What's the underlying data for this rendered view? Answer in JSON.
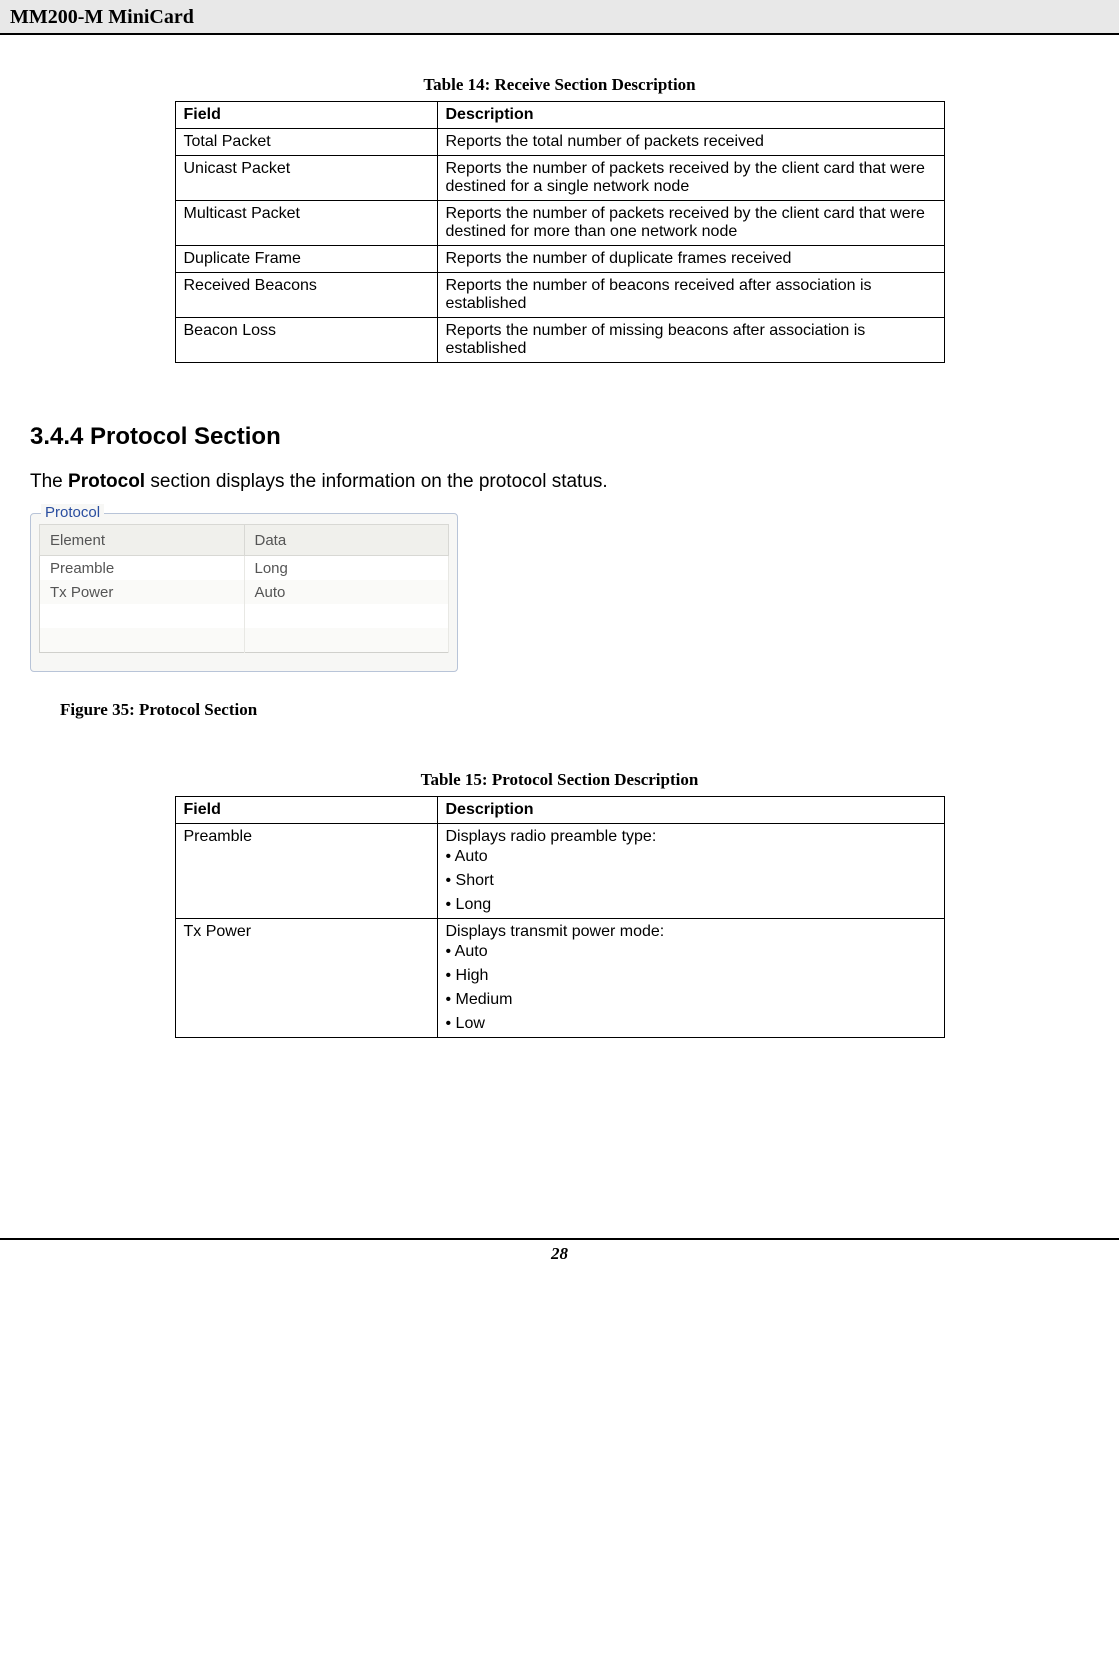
{
  "header": {
    "title": "MM200-M MiniCard"
  },
  "table14": {
    "caption": "Table 14: Receive Section Description",
    "head_field": "Field",
    "head_desc": "Description",
    "rows": [
      {
        "field": "Total Packet",
        "desc": "Reports the total number of packets received"
      },
      {
        "field": "Unicast Packet",
        "desc": "Reports the number of packets received by the client card that were destined for\na single network node"
      },
      {
        "field": "Multicast Packet",
        "desc": "Reports the number of packets received by the client card that were destined for\nmore than one network node"
      },
      {
        "field": "Duplicate Frame",
        "desc": "Reports the number of duplicate frames received"
      },
      {
        "field": "Received Beacons",
        "desc": "Reports the number of beacons received after association is established"
      },
      {
        "field": "Beacon Loss",
        "desc": "Reports the number of missing beacons after association is established"
      }
    ]
  },
  "section": {
    "heading": "3.4.4 Protocol Section",
    "intro_pre": "The ",
    "intro_bold": "Protocol",
    "intro_post": " section displays the information on the protocol status."
  },
  "widget": {
    "legend": "Protocol",
    "col1": "Element",
    "col2": "Data",
    "rows": [
      {
        "el": "Preamble",
        "dt": "Long"
      },
      {
        "el": "Tx Power",
        "dt": "Auto"
      },
      {
        "el": "",
        "dt": ""
      },
      {
        "el": "",
        "dt": ""
      }
    ],
    "figcap": "Figure 35: Protocol Section"
  },
  "table15": {
    "caption": "Table 15: Protocol Section Description",
    "head_field": "Field",
    "head_desc": "Description",
    "rows": [
      {
        "field": "Preamble",
        "lead": "Displays radio preamble type:",
        "bullets": [
          "Auto",
          "Short",
          "Long"
        ]
      },
      {
        "field": "Tx Power",
        "lead": "Displays transmit power mode:",
        "bullets": [
          "Auto",
          "High",
          "Medium",
          "Low"
        ]
      }
    ]
  },
  "footer": {
    "page": "28"
  }
}
